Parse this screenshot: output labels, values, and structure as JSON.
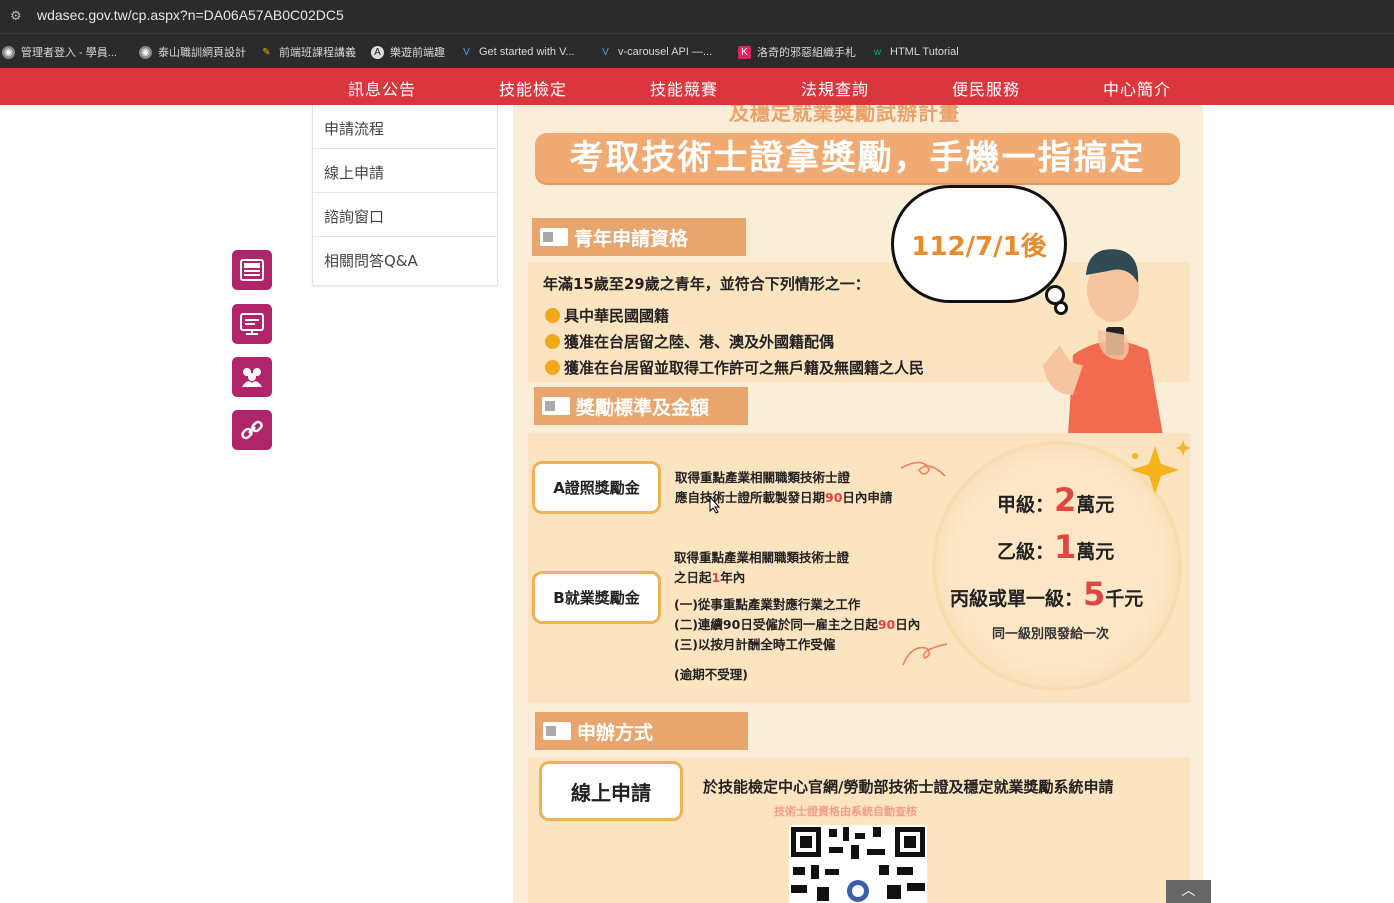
{
  "browser": {
    "url": "wdasec.gov.tw/cp.aspx?n=DA06A57AB0C02DC5",
    "bookmarks": [
      {
        "label": "管理者登入 - 學員...",
        "icon": "globe-icon"
      },
      {
        "label": "泰山職訓網頁設計",
        "icon": "globe-icon"
      },
      {
        "label": "前端班課程講義",
        "icon": "pencil-icon"
      },
      {
        "label": "樂遊前端趣",
        "icon": "angular-icon"
      },
      {
        "label": "Get started with V...",
        "icon": "vuetify-icon"
      },
      {
        "label": "v-carousel API —...",
        "icon": "vuetify-icon"
      },
      {
        "label": "洛奇的邪惡組織手札",
        "icon": "bookmark-icon"
      },
      {
        "label": "HTML Tutorial",
        "icon": "w3-icon"
      }
    ]
  },
  "nav": {
    "items": [
      "訊息公告",
      "技能檢定",
      "技能競賽",
      "法規查詢",
      "便民服務",
      "中心簡介"
    ],
    "color": "#d9363e"
  },
  "sidemenu": {
    "items": [
      "申請流程",
      "線上申請",
      "諮詢窗口",
      "相關問答Q&A"
    ]
  },
  "side_icons": [
    "news-icon",
    "monitor-icon",
    "people-icon",
    "link-icon"
  ],
  "poster": {
    "top_partial": "及穩定就業獎勵試辦計畫",
    "title": "考取技術士證拿獎勵，手機一指搞定",
    "cloud_date": "112/7/1後",
    "eligibility": {
      "heading": "青年申請資格",
      "intro": "年滿15歲至29歲之青年，並符合下列情形之一：",
      "bullets": [
        "具中華民國國籍",
        "獲准在台居留之陸、港、澳及外國籍配偶",
        "獲准在台居留並取得工作許可之無戶籍及無國籍之人民"
      ]
    },
    "reward": {
      "heading": "獎勵標準及金額",
      "a_label": "A證照獎勵金",
      "a_line1": "取得重點產業相關職類技術士證",
      "a_line2_pre": "應自技術士證所載製發日期",
      "a_line2_num": "90",
      "a_line2_post": "日內申請",
      "b_label": "B就業獎勵金",
      "b_line1": "取得重點產業相關職類技術士證",
      "b_line2_pre": "之日起",
      "b_line2_num": "1",
      "b_line2_post": "年內",
      "b_item1": "(一)從事重點產業對應行業之工作",
      "b_item2_pre": "(二)連續90日受僱於同一雇主之日起",
      "b_item2_num": "90",
      "b_item2_post": "日內",
      "b_item3": "(三)以按月計酬全時工作受僱",
      "b_note": "(逾期不受理)",
      "grades": [
        {
          "label": "甲級：",
          "num": "2",
          "unit": "萬元"
        },
        {
          "label": "乙級：",
          "num": "1",
          "unit": "萬元"
        },
        {
          "label": "丙級或單一級：",
          "num": "5",
          "unit": "千元"
        }
      ],
      "grade_note": "同一級別限發給一次"
    },
    "method": {
      "heading": "申辦方式",
      "online_label": "線上申請",
      "online_desc": "於技能檢定中心官網/勞動部技術士證及穩定就業獎勵系統申請",
      "online_sub": "技術士證資格由系統自動查核"
    }
  },
  "scroll_top": "︿"
}
